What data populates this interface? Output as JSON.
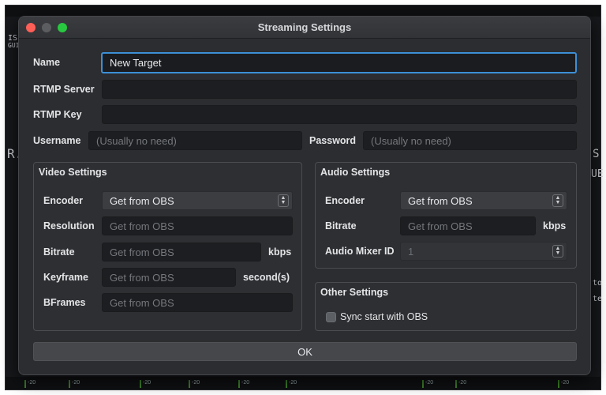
{
  "dialog": {
    "title": "Streaming Settings",
    "name_label": "Name",
    "name_value": "New Target",
    "rtmp_server_label": "RTMP Server",
    "rtmp_server_value": "",
    "rtmp_key_label": "RTMP Key",
    "rtmp_key_value": "",
    "username_label": "Username",
    "username_placeholder": "(Usually no need)",
    "password_label": "Password",
    "password_placeholder": "(Usually no need)",
    "ok_label": "OK"
  },
  "video": {
    "title": "Video Settings",
    "encoder_label": "Encoder",
    "encoder_value": "Get from OBS",
    "resolution_label": "Resolution",
    "resolution_value": "Get from OBS",
    "bitrate_label": "Bitrate",
    "bitrate_value": "Get from OBS",
    "bitrate_unit": "kbps",
    "keyframe_label": "Keyframe",
    "keyframe_value": "Get from OBS",
    "keyframe_unit": "second(s)",
    "bframes_label": "BFrames",
    "bframes_value": "Get from OBS"
  },
  "audio": {
    "title": "Audio Settings",
    "encoder_label": "Encoder",
    "encoder_value": "Get from OBS",
    "bitrate_label": "Bitrate",
    "bitrate_value": "Get from OBS",
    "bitrate_unit": "kbps",
    "mixer_label": "Audio Mixer ID",
    "mixer_value": "1"
  },
  "other": {
    "title": "Other Settings",
    "sync_label": "Sync start with OBS"
  },
  "background": {
    "left_text": "IS",
    "left_text2": "GUI",
    "left_r": "R.",
    "right_s": "S",
    "right_ue": "UE",
    "right_to": "to",
    "right_te": "te",
    "meter_label": "-20"
  },
  "colors": {
    "dialog_bg": "#2b2d30",
    "field_bg": "#1d1e21",
    "focus_border": "#3c8fd6",
    "close": "#fe5f57",
    "maximize": "#28c840"
  }
}
